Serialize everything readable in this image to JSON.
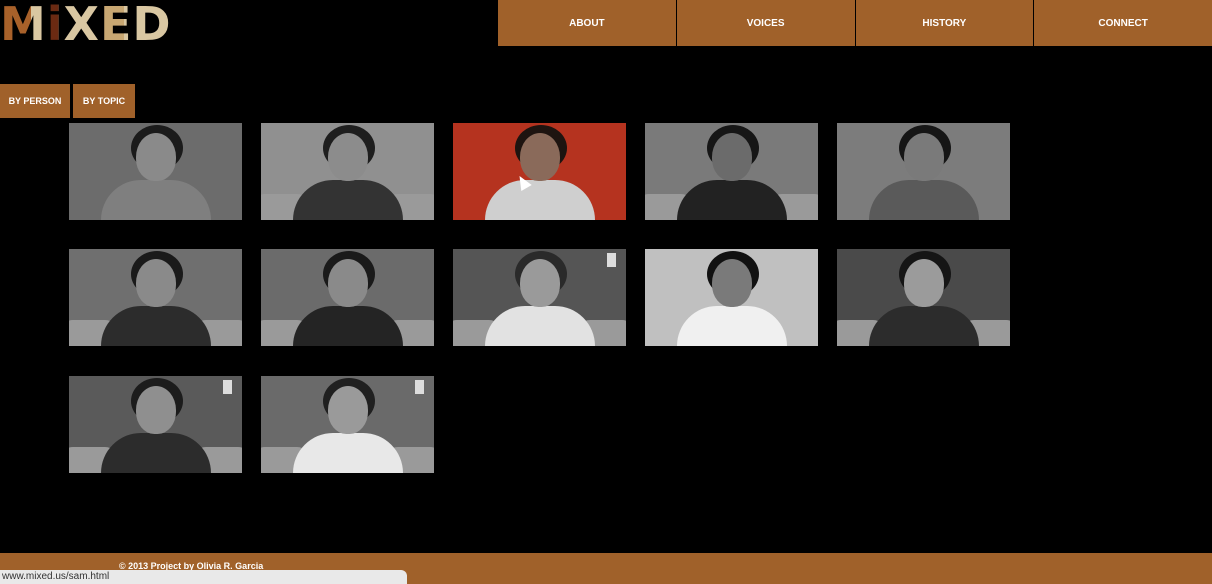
{
  "logo": {
    "text": "MiXED"
  },
  "nav": {
    "items": [
      {
        "label": "ABOUT"
      },
      {
        "label": "VOICES"
      },
      {
        "label": "HISTORY"
      },
      {
        "label": "CONNECT"
      }
    ]
  },
  "filters": {
    "by_person": "BY PERSON",
    "by_topic": "BY TOPIC"
  },
  "people": [
    {
      "tint": "gray"
    },
    {
      "tint": "gray"
    },
    {
      "tint": "red"
    },
    {
      "tint": "gray"
    },
    {
      "tint": "gray"
    },
    {
      "tint": "gray"
    },
    {
      "tint": "gray"
    },
    {
      "tint": "gray"
    },
    {
      "tint": "gray"
    },
    {
      "tint": "gray"
    },
    {
      "tint": "gray"
    },
    {
      "tint": "gray"
    }
  ],
  "colors": {
    "accent": "#a0612a",
    "background": "#000000",
    "highlight": "#b5331f"
  },
  "footer": {
    "copyright": "© 2013 Project by Olivia R. Garcia"
  },
  "status_bar": {
    "url": "www.mixed.us/sam.html"
  }
}
